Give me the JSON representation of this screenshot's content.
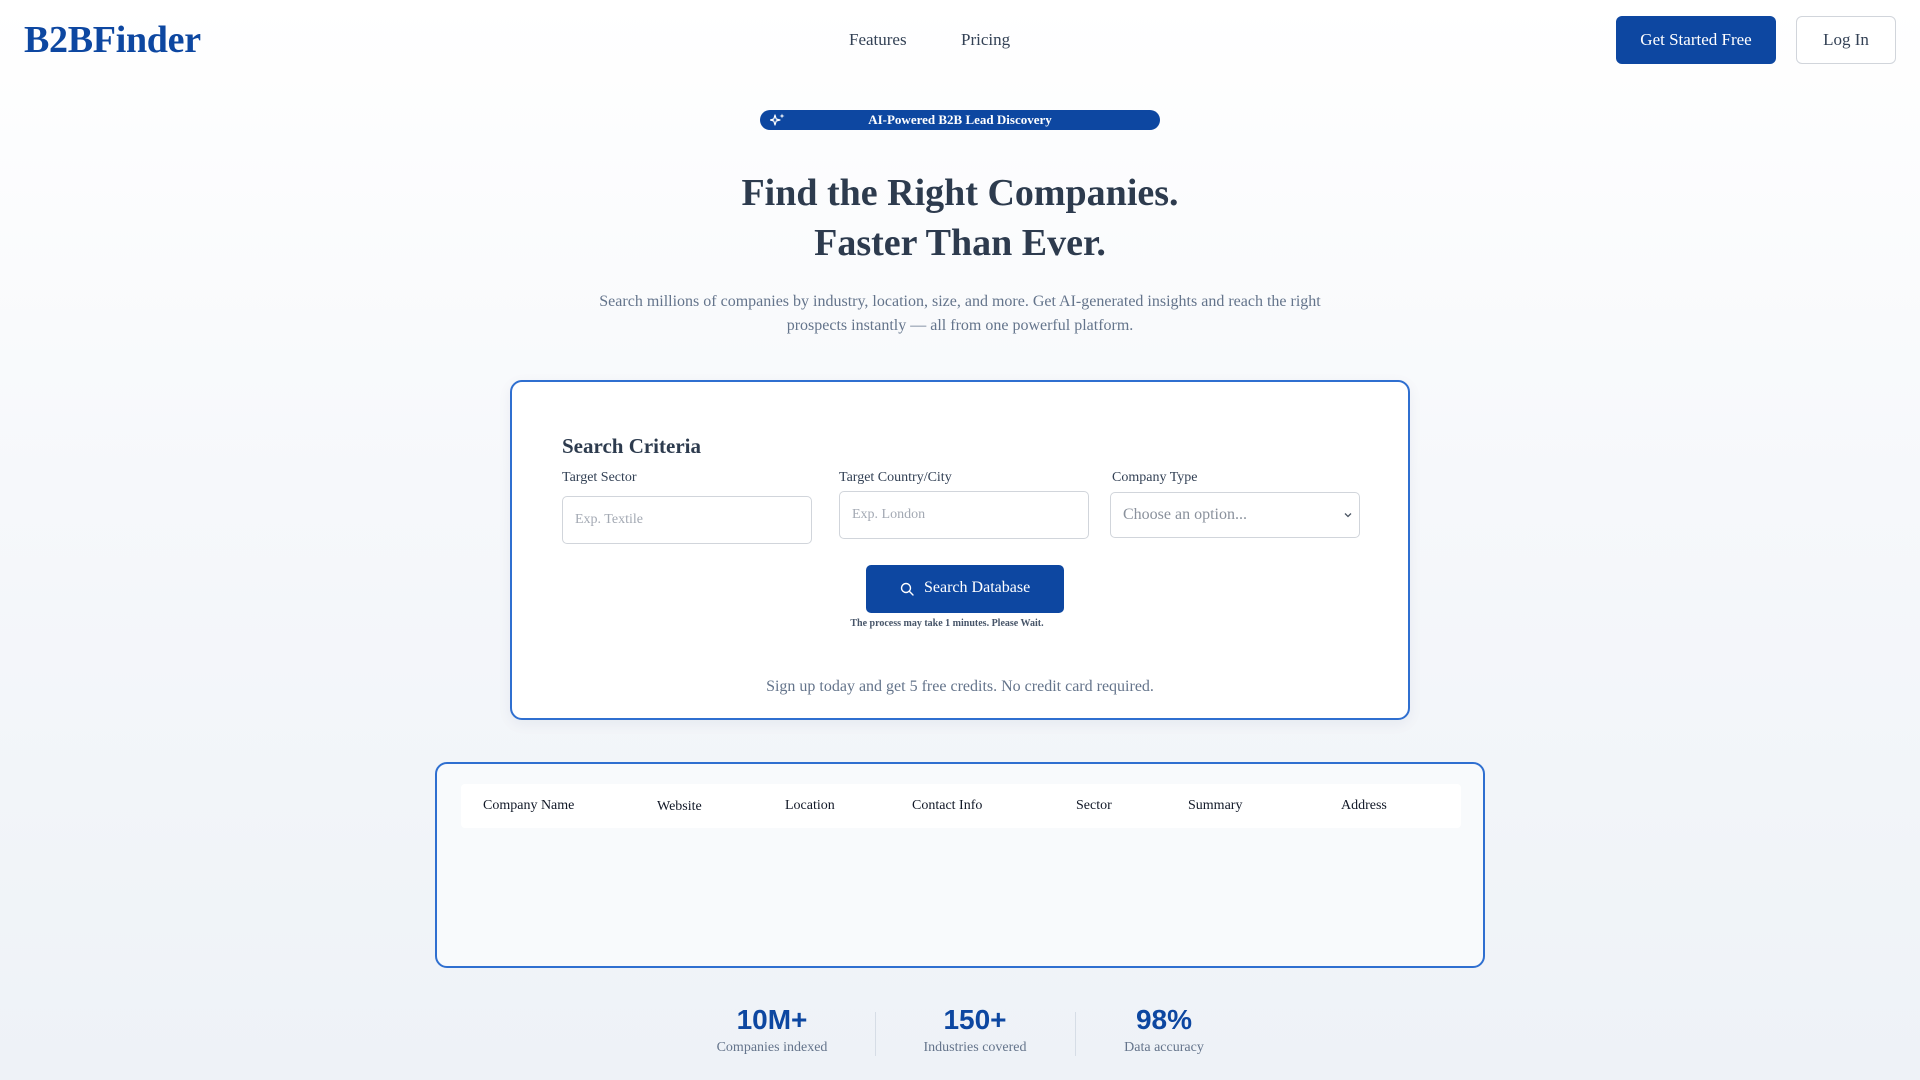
{
  "header": {
    "logo": "B2BFinder",
    "nav": [
      {
        "label": "Features"
      },
      {
        "label": "Pricing"
      }
    ],
    "cta_label": "Get Started Free",
    "login_label": "Log In"
  },
  "badge": {
    "label": "AI-Powered B2B Lead Discovery",
    "icon": "sparkle-icon"
  },
  "hero": {
    "title_line1": "Find the Right Companies.",
    "title_line2": "Faster Than Ever.",
    "subtitle": "Search millions of companies by industry, location, size, and more. Get AI-generated insights and reach the right prospects instantly — all from one powerful platform."
  },
  "search": {
    "title": "Search Criteria",
    "sector": {
      "label": "Target Sector",
      "placeholder": "Exp. Textile",
      "value": ""
    },
    "location": {
      "label": "Target Country/City",
      "placeholder": "Exp. London",
      "value": ""
    },
    "company_type": {
      "label": "Company Type",
      "selected": "Choose an option..."
    },
    "button_label": "Search Database",
    "note": "The process may take 1 minutes. Please Wait.",
    "signup_note": "Sign up today and get 5 free credits. No credit card required."
  },
  "results": {
    "columns": [
      "Company Name",
      "Website",
      "Location",
      "Contact Info",
      "Sector",
      "Summary",
      "Address"
    ],
    "rows": []
  },
  "stats": [
    {
      "value": "10M+",
      "label": "Companies indexed"
    },
    {
      "value": "150+",
      "label": "Industries covered"
    },
    {
      "value": "98%",
      "label": "Data accuracy"
    }
  ],
  "colors": {
    "brand": "#0d47a1",
    "card_border": "#2f6fd0",
    "text_dark": "#2d3b4e",
    "text_muted": "#64748b"
  }
}
